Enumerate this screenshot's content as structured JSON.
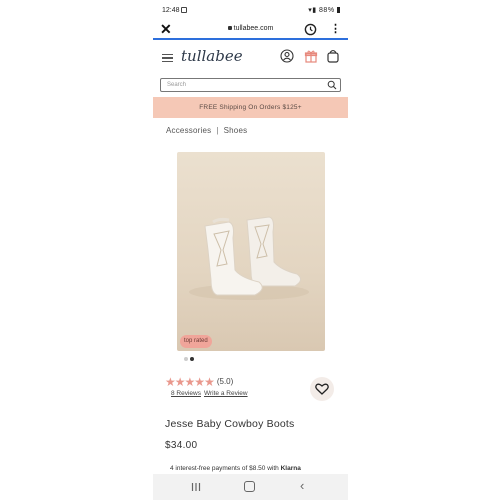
{
  "status_bar": {
    "time": "12:48",
    "battery": "88%"
  },
  "browser": {
    "url": "tullabee.com"
  },
  "header": {
    "logo": "tullabee"
  },
  "search": {
    "placeholder": "Search"
  },
  "banner": {
    "text": "FREE Shipping On Orders $125+"
  },
  "breadcrumb": {
    "items": [
      "Accessories",
      "Shoes"
    ],
    "separator": "|"
  },
  "product": {
    "badge": "top rated",
    "rating_value": 5,
    "rating_text": "(5.0)",
    "reviews_link": "8 Reviews",
    "write_review_link": "Write a Review",
    "title": "Jesse Baby Cowboy Boots",
    "price": "$34.00",
    "installments_prefix": "4 interest-free payments of $8.50 with",
    "installments_brand": "Klarna"
  },
  "colors": {
    "accent": "#f5c8b6",
    "star": "#e9988d",
    "badge": "#f0a59a",
    "progress": "#2d6fdc"
  },
  "icons": [
    "close-icon",
    "history-icon",
    "more-icon",
    "menu-icon",
    "user-icon",
    "gift-icon",
    "bag-icon",
    "search-icon",
    "heart-icon"
  ]
}
